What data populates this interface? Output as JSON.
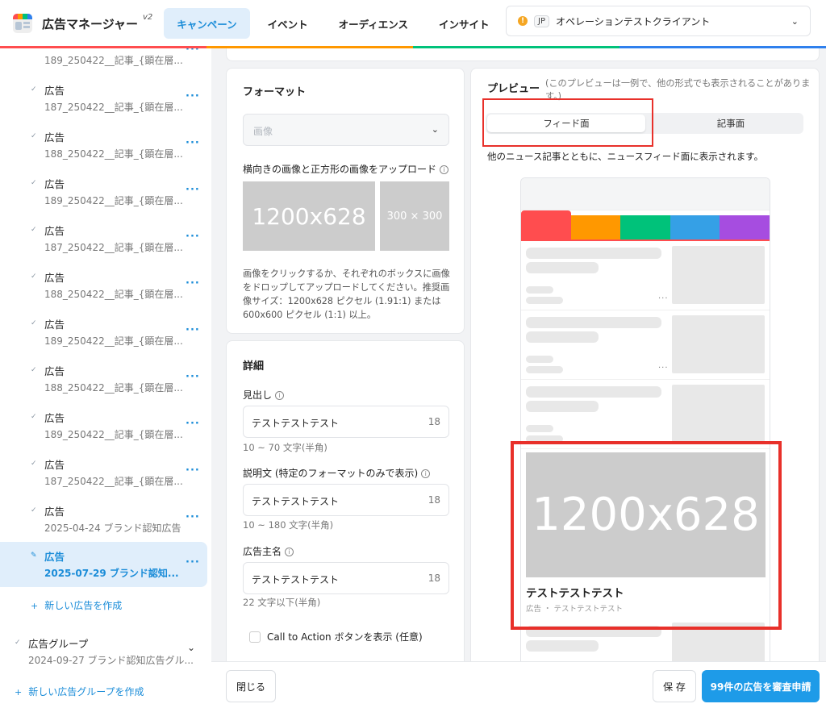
{
  "header": {
    "app_title": "広告マネージャー",
    "version": "v2",
    "nav": [
      "キャンペーン",
      "イベント",
      "オーディエンス",
      "インサイト"
    ],
    "client_warn": "!",
    "client_region": "JP",
    "client_name": "オペレーションテストクライアント",
    "accent_color": "#1a8cd8"
  },
  "sidebar": {
    "top_partial": "189_250422__記事_{顕在層...",
    "items": [
      {
        "label": "広告",
        "sub": "187_250422__記事_{顕在層..."
      },
      {
        "label": "広告",
        "sub": "188_250422__記事_{顕在層..."
      },
      {
        "label": "広告",
        "sub": "189_250422__記事_{顕在層..."
      },
      {
        "label": "広告",
        "sub": "187_250422__記事_{顕在層..."
      },
      {
        "label": "広告",
        "sub": "188_250422__記事_{顕在層..."
      },
      {
        "label": "広告",
        "sub": "189_250422__記事_{顕在層..."
      },
      {
        "label": "広告",
        "sub": "188_250422__記事_{顕在層..."
      },
      {
        "label": "広告",
        "sub": "189_250422__記事_{顕在層..."
      },
      {
        "label": "広告",
        "sub": "187_250422__記事_{顕在層..."
      },
      {
        "label": "広告",
        "sub": "2025-04-24 ブランド認知広告"
      },
      {
        "label": "広告",
        "sub": "2025-07-29 ブランド認知..."
      }
    ],
    "more": "···",
    "new_ad": "新しい広告を作成",
    "group": {
      "label": "広告グループ",
      "sub": "2024-09-27 ブランド認知広告グル..."
    },
    "new_group": "新しい広告グループを作成"
  },
  "format": {
    "title": "フォーマット",
    "select_placeholder": "画像",
    "upload_label": "横向きの画像と正方形の画像をアップロード",
    "img_big": "1200x628",
    "img_sq": "300 × 300",
    "help": "画像をクリックするか、それぞれのボックスに画像をドロップしてアップロードしてください。推奨画像サイズ：1200x628 ピクセル (1.91:1) または 600x600 ピクセル (1:1) 以上。"
  },
  "details": {
    "title": "詳細",
    "headline_label": "見出し",
    "headline_value": "テストテストテスト",
    "headline_count": "18",
    "headline_hint": "10 ~ 70 文字(半角)",
    "desc_label": "説明文 (特定のフォーマットのみで表示)",
    "desc_value": "テストテストテスト",
    "desc_count": "18",
    "desc_hint": "10 ~ 180 文字(半角)",
    "advertiser_label": "広告主名",
    "advertiser_value": "テストテストテスト",
    "advertiser_count": "18",
    "advertiser_hint": "22 文字以下(半角)",
    "cta_label": "Call to Action ボタンを表示 (任意)"
  },
  "preview": {
    "title": "プレビュー",
    "note": "(このプレビューは一例で、他の形式でも表示されることがあります。)",
    "tab_feed": "フィード面",
    "tab_article": "記事面",
    "desc": "他のニュース記事とともに、ニュースフィード面に表示されます。",
    "feat_img": "1200x628",
    "feat_title": "テストテストテスト",
    "feat_sub": "広告 ・ テストテストテスト",
    "tab_colors": [
      "#ff4d4f",
      "#ff9800",
      "#00c27a",
      "#35a0e6",
      "#a64de0"
    ]
  },
  "footer": {
    "close": "閉じる",
    "save": "保 存",
    "submit": "99件の広告を審査申請"
  }
}
